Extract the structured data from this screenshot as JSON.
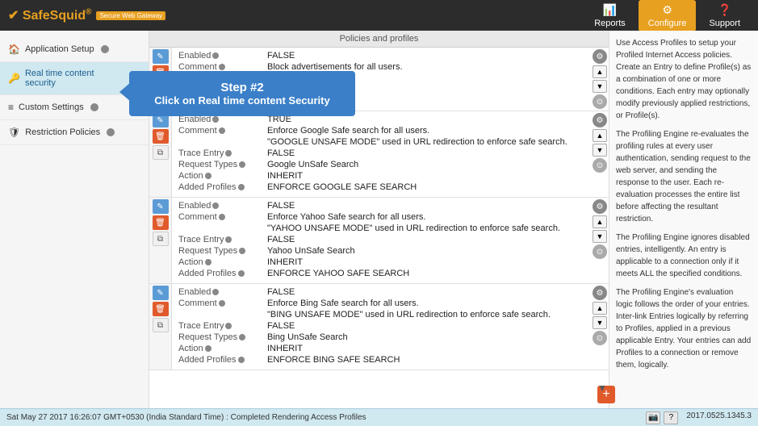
{
  "header": {
    "logo_name": "SafeSquid",
    "logo_reg": "®",
    "logo_sub": "Secure Web Gateway",
    "nav": [
      {
        "label": "Reports",
        "icon": "📊",
        "active": false
      },
      {
        "label": "Configure",
        "icon": "⚙",
        "active": true
      },
      {
        "label": "Support",
        "icon": "❓",
        "active": false
      }
    ]
  },
  "sidebar": {
    "items": [
      {
        "label": "Application Setup",
        "icon": "🏠",
        "info": true,
        "active": false
      },
      {
        "label": "Real time content security",
        "icon": "🔑",
        "info": true,
        "active": true
      },
      {
        "label": "Custom Settings",
        "icon": "≡",
        "info": true,
        "active": false
      },
      {
        "label": "Restriction Policies",
        "icon": "🛡",
        "info": true,
        "active": false
      }
    ]
  },
  "policies_header": "Policies and profiles",
  "step_overlay": {
    "line1": "Step #2",
    "line2": "Click on Real time content Security"
  },
  "policies": [
    {
      "id": "policy1",
      "fields": [
        {
          "label": "Enabled",
          "value": "FALSE",
          "info": true
        },
        {
          "label": "Comment",
          "value": "Block advertisements for all users.",
          "info": true
        }
      ]
    },
    {
      "id": "policy2",
      "fields": [
        {
          "label": "Enabled",
          "value": "TRUE",
          "info": true
        },
        {
          "label": "Comment",
          "value": "Enforce Google Safe search for all users.",
          "info": true
        },
        {
          "label": "",
          "value": "\"GOOGLE UNSAFE MODE\" used in URL redirection to enforce safe search.",
          "info": false
        },
        {
          "label": "Trace Entry",
          "value": "FALSE",
          "info": true
        },
        {
          "label": "Request Types",
          "value": "Google UnSafe Search",
          "info": true
        },
        {
          "label": "Action",
          "value": "INHERIT",
          "info": true
        },
        {
          "label": "Added Profiles",
          "value": "ENFORCE GOOGLE SAFE SEARCH",
          "info": true
        }
      ]
    },
    {
      "id": "policy3",
      "fields": [
        {
          "label": "Enabled",
          "value": "FALSE",
          "info": true
        },
        {
          "label": "Comment",
          "value": "Enforce Yahoo Safe search for all users.",
          "info": true
        },
        {
          "label": "",
          "value": "\"YAHOO UNSAFE MODE\" used in URL redirection to enforce safe search.",
          "info": false
        },
        {
          "label": "Trace Entry",
          "value": "FALSE",
          "info": true
        },
        {
          "label": "Request Types",
          "value": "Yahoo UnSafe Search",
          "info": true
        },
        {
          "label": "Action",
          "value": "INHERIT",
          "info": true
        },
        {
          "label": "Added Profiles",
          "value": "ENFORCE YAHOO SAFE SEARCH",
          "info": true
        }
      ]
    },
    {
      "id": "policy4",
      "fields": [
        {
          "label": "Enabled",
          "value": "FALSE",
          "info": true
        },
        {
          "label": "Comment",
          "value": "Enforce Bing Safe search for all users.",
          "info": true
        },
        {
          "label": "",
          "value": "\"BING UNSAFE MODE\" used in URL redirection to enforce safe search.",
          "info": false
        },
        {
          "label": "Trace Entry",
          "value": "FALSE",
          "info": true
        },
        {
          "label": "Request Types",
          "value": "Bing UnSafe Search",
          "info": true
        },
        {
          "label": "Action",
          "value": "INHERIT",
          "info": true
        },
        {
          "label": "Added Profiles",
          "value": "ENFORCE BING SAFE SEARCH",
          "info": true
        }
      ]
    }
  ],
  "right_panel": {
    "text1": "Use Access Profiles to setup your Profiled Internet Access policies. Create an Entry to define Profile(s) as a combination of one or more conditions. Each entry may optionally modify previously applied restrictions, or Profile(s).",
    "text2": "The Profiling Engine re-evaluates the profiling rules at every user authentication, sending request to the web server, and sending the response to the user. Each re-evaluation processes the entire list before affecting the resultant restriction.",
    "text3": "The Profiling Engine ignores disabled entries, intelligently. An entry is applicable to a connection only if it meets ALL the specified conditions.",
    "text4": "The Profiling Engine's evaluation logic follows the order of your entries. Inter-link Entries logically by referring to Profiles, applied in a previous applicable Entry. Your entries can add Profiles to a connection or remove them, logically."
  },
  "bottom_bar": {
    "status": "Sat May 27 2017 16:26:07 GMT+0530 (India Standard Time) : Completed Rendering Access Profiles",
    "version": "2017.0525.1345.3"
  },
  "add_button_label": "+"
}
